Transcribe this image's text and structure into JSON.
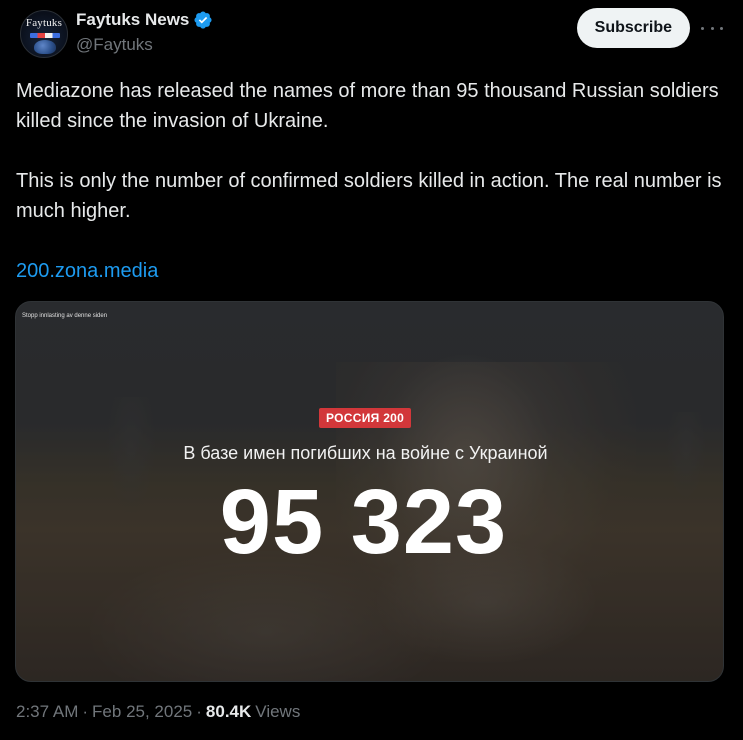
{
  "author": {
    "display_name": "Faytuks News",
    "handle": "@Faytuks",
    "avatar_text": "Faytuks",
    "verified_color": "#1d9bf0"
  },
  "actions": {
    "subscribe_label": "Subscribe",
    "more_icon": "more-horizontal-icon"
  },
  "tweet": {
    "paragraph_1": "Mediazone has released the names of more than 95 thousand Russian soldiers killed since the invasion of Ukraine.",
    "paragraph_2": "This is only the number of confirmed soldiers killed in action. The real number is much higher.",
    "link": "200.zona.media"
  },
  "media": {
    "overlay_note": "Stopp innlasting av denne siden",
    "badge": "РОССИЯ 200",
    "badge_color": "#d2373a",
    "subtitle": "В базе имен погибших на войне с Украиной",
    "number": "95 323"
  },
  "meta": {
    "time": "2:37 AM",
    "separator_1": "·",
    "date": "Feb 25, 2025",
    "separator_2": "·",
    "views_count": "80.4K",
    "views_label": "Views"
  },
  "colors": {
    "background": "#000000",
    "text": "#e7e9ea",
    "muted": "#71767b",
    "link": "#1d9bf0"
  }
}
